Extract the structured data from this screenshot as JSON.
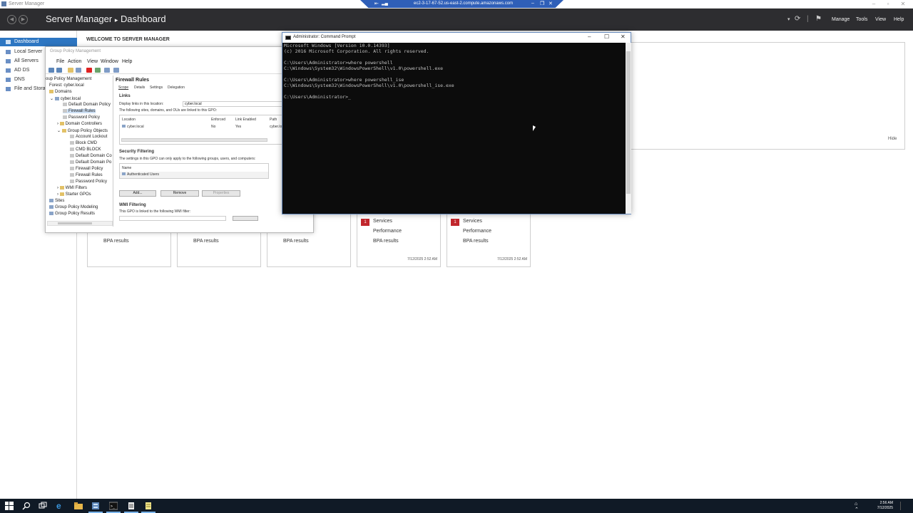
{
  "server_manager": {
    "window_title": "Server Manager",
    "header": {
      "breadcrumb_root": "Server Manager",
      "separator": "▸",
      "page": "Dashboard",
      "menu": [
        "Manage",
        "Tools",
        "View",
        "Help"
      ]
    },
    "sidebar": [
      "Dashboard",
      "Local Server",
      "All Servers",
      "AD DS",
      "DNS",
      "File and Storag"
    ],
    "welcome_title": "WELCOME TO SERVER MANAGER",
    "hide_label": "Hide",
    "tiles": [
      {
        "rows": [
          "BPA results"
        ]
      },
      {
        "rows": [
          "BPA results"
        ]
      },
      {
        "rows": [
          "BPA results"
        ]
      },
      {
        "badge": "1",
        "rows": [
          "Services",
          "Performance",
          "BPA results"
        ],
        "timestamp": "7/12/2025 2:52 AM"
      },
      {
        "badge": "1",
        "rows": [
          "Services",
          "Performance",
          "BPA results"
        ],
        "timestamp": "7/12/2025 2:52 AM"
      }
    ]
  },
  "rdp_bar": {
    "host": "ec2-3-17-67-52.us-east-2.compute.amazonaws.com"
  },
  "gpm": {
    "title": "Group Policy Management",
    "menu": [
      "File",
      "Action",
      "View",
      "Window",
      "Help"
    ],
    "tree": [
      "oup Policy Management",
      "Forest: cyber.local",
      "Domains",
      "cyber.local",
      "Default Domain Policy",
      "Firewall Rules",
      "Password Policy",
      "Domain Controllers",
      "Group Policy Objects",
      "Account Lockout",
      "Block CMD",
      "CMD BLOCK",
      "Default Domain Co",
      "Default Domain Po",
      "Firewall Policy",
      "Firewall Rules",
      "Password Policy",
      "WMI Filters",
      "Starter GPOs",
      "Sites",
      "Group Policy Modeling",
      "Group Policy Results"
    ],
    "pane": {
      "title": "Firewall Rules",
      "tabs": [
        "Scope",
        "Details",
        "Settings",
        "Delegation"
      ],
      "links_heading": "Links",
      "display_links_label": "Display links in this location:",
      "display_links_value": "cyber.local",
      "links_desc": "The following sites, domains, and OUs are linked to this GPO:",
      "links_columns": [
        "Location",
        "Enforced",
        "Link Enabled",
        "Path"
      ],
      "links_row": [
        "cyber.local",
        "No",
        "Yes",
        "cyber.lo"
      ],
      "security_heading": "Security Filtering",
      "security_desc": "The settings in this GPO can only apply to the following groups, users, and computers:",
      "security_column": "Name",
      "security_row": "Authenticated Users",
      "buttons": [
        "Add...",
        "Remove",
        "Properties"
      ],
      "wmi_heading": "WMI Filtering",
      "wmi_desc": "This GPO is linked to the following WMI filter:"
    }
  },
  "cmd": {
    "title": "Administrator: Command Prompt",
    "lines": [
      "Microsoft Windows [Version 10.0.14393]",
      "(c) 2016 Microsoft Corporation. All rights reserved.",
      "",
      "C:\\Users\\Administrator>where powershell",
      "C:\\Windows\\System32\\WindowsPowerShell\\v1.0\\powershell.exe",
      "",
      "C:\\Users\\Administrator>where powershell_ise",
      "C:\\Windows\\System32\\WindowsPowerShell\\v1.0\\powershell_ise.exe",
      "",
      "C:\\Users\\Administrator>_"
    ]
  },
  "taskbar": {
    "time": "2:56 AM",
    "date": "7/12/2025"
  },
  "colors": {
    "header_bg": "#2d2d30",
    "sidebar_active": "#2d76c2",
    "alert_red": "#c1272d",
    "console_bg": "#0c0c0c",
    "taskbar_bg": "#101a26",
    "rdp_bar": "#2f5fb8"
  }
}
